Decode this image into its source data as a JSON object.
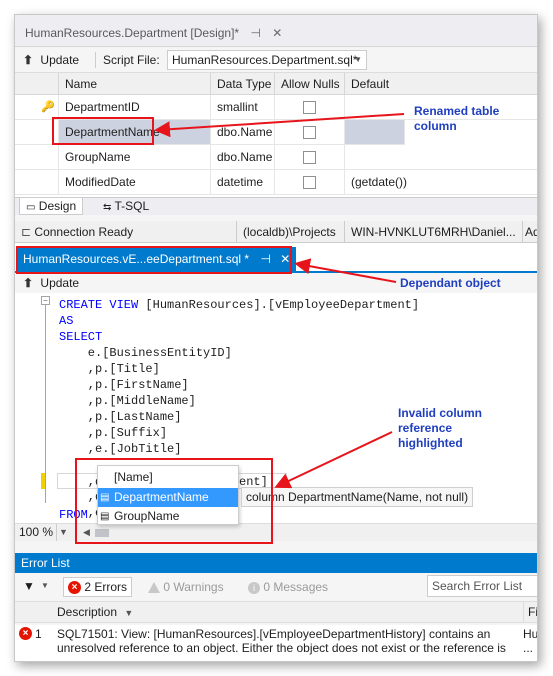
{
  "designer": {
    "tab_title": "HumanResources.Department [Design]*",
    "tab_pin": "⊣",
    "tab_close": "✕",
    "update_label": "Update",
    "script_file_label": "Script File:",
    "script_file_value": "HumanResources.Department.sql*",
    "columns": [
      "Name",
      "Data Type",
      "Allow Nulls",
      "Default"
    ],
    "rows": [
      {
        "name": "DepartmentID",
        "type": "smallint",
        "default": ""
      },
      {
        "name": "DepartmentName",
        "type": "dbo.Name",
        "default": ""
      },
      {
        "name": "GroupName",
        "type": "dbo.Name",
        "default": ""
      },
      {
        "name": "ModifiedDate",
        "type": "datetime",
        "default": "(getdate())"
      }
    ],
    "bottom_tabs": [
      "Design",
      "T-SQL"
    ]
  },
  "status": {
    "connection": "Connection Ready",
    "server": "(localdb)\\Projects",
    "user": "WIN-HVNKLUT6MRH\\Daniel...",
    "extra": "Ad"
  },
  "editor": {
    "tab_title": "HumanResources.vE...eeDepartment.sql *",
    "tab_pin": "⊣",
    "tab_close": "✕",
    "update_label": "Update",
    "lines": [
      {
        "kw": "CREATE VIEW ",
        "rest": "[HumanResources].[vEmployeeDepartment]"
      },
      {
        "kw": "AS",
        "rest": ""
      },
      {
        "kw": "SELECT",
        "rest": ""
      },
      {
        "kw": "",
        "rest": "    e.[BusinessEntityID]"
      },
      {
        "kw": "",
        "rest": "    ,p.[Title]"
      },
      {
        "kw": "",
        "rest": "    ,p.[FirstName]"
      },
      {
        "kw": "",
        "rest": "    ,p.[MiddleName]"
      },
      {
        "kw": "",
        "rest": "    ,p.[LastName]"
      },
      {
        "kw": "",
        "rest": "    ,p.[Suffix]"
      },
      {
        "kw": "",
        "rest": "    ,e.[JobTitle]"
      },
      {
        "kw": "",
        "rest": "    ,d.[Name] AS [Department]"
      },
      {
        "kw": "",
        "rest": "    ,d."
      },
      {
        "kw": "",
        "rest": "    ,ed"
      },
      {
        "kw": "FROM ",
        "rest": "[H"
      }
    ],
    "popup_items": [
      "[Name]",
      "DepartmentName",
      "GroupName"
    ],
    "tooltip": "column DepartmentName(Name, not null)",
    "zoom": "100 %"
  },
  "errors": {
    "header": "Error List",
    "errors_btn": "2 Errors",
    "warnings_btn": "0 Warnings",
    "messages_btn": "0 Messages",
    "search_placeholder": "Search Error List",
    "col_description": "Description",
    "col_file": "Fi",
    "row_num": "1",
    "row_text_1": "SQL71501: View: [HumanResources].[vEmployeeDepartmentHistory] contains an",
    "row_text_2": "unresolved reference to an object. Either the object does not exist or the reference is",
    "row_file": "Hu",
    "row_file2": "..."
  },
  "annotations": {
    "renamed": "Renamed table\ncolumn",
    "dependant": "Dependant object",
    "invalid": "Invalid column\nreference\nhighlighted"
  },
  "colors": {
    "accent": "#007acc",
    "annotation": "#1f3fbf",
    "highlight_box": "#e8141c"
  }
}
